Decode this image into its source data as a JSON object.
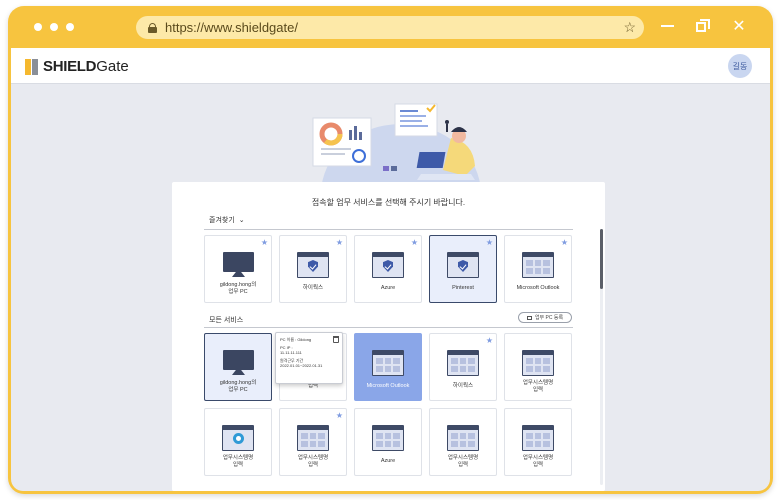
{
  "browser": {
    "url": "https://www.shieldgate/"
  },
  "app": {
    "logo_bold": "SHIELD",
    "logo_rest": "Gate",
    "avatar_text": "길동"
  },
  "panel": {
    "instruction": "접속할 업무 서비스를 선택해 주시기 바랍니다.",
    "favorites_label": "즐겨찾기",
    "all_services_label": "모든 서비스",
    "register_pc_button": "업무 PC 등록"
  },
  "favorites": [
    {
      "label": "gildong.hong의\n업무 PC",
      "icon": "monitor-icon",
      "starred": true,
      "state": "normal"
    },
    {
      "label": "하이웍스",
      "icon": "shield-window-icon",
      "starred": true,
      "state": "normal"
    },
    {
      "label": "Azure",
      "icon": "shield-window-icon",
      "starred": true,
      "state": "normal"
    },
    {
      "label": "Pinterest",
      "icon": "shield-window-icon",
      "starred": true,
      "state": "selected"
    },
    {
      "label": "Microsoft Outlook",
      "icon": "grid-window-icon",
      "starred": true,
      "state": "normal"
    }
  ],
  "all_services": [
    {
      "label": "gildong.hong의\n업무 PC",
      "icon": "monitor-icon",
      "starred": false,
      "state": "selected"
    },
    {
      "label": "입력",
      "icon": "grid-window-icon",
      "starred": false,
      "state": "normal"
    },
    {
      "label": "Microsoft Outlook",
      "icon": "grid-window-icon",
      "starred": false,
      "state": "active"
    },
    {
      "label": "하이웍스",
      "icon": "grid-window-icon",
      "starred": true,
      "state": "normal"
    },
    {
      "label": "업무시스템명\n입력",
      "icon": "grid-window-icon",
      "starred": false,
      "state": "normal"
    },
    {
      "label": "업무시스템명\n입력",
      "icon": "camera-window-icon",
      "starred": false,
      "state": "normal"
    },
    {
      "label": "업무시스템명\n입력",
      "icon": "grid-window-icon",
      "starred": true,
      "state": "normal"
    },
    {
      "label": "Azure",
      "icon": "grid-window-icon",
      "starred": false,
      "state": "normal"
    },
    {
      "label": "업무시스템명\n입력",
      "icon": "grid-window-icon",
      "starred": false,
      "state": "normal"
    },
    {
      "label": "업무시스템명\n입력",
      "icon": "grid-window-icon",
      "starred": false,
      "state": "normal"
    }
  ],
  "tooltip": {
    "pc_name": "PC 이름 : Gildong",
    "pc_ip_label": "PC IP :",
    "pc_ip": "11.11.11.111",
    "period_label": "원격근무 기간",
    "period": "2022.01.01~2022.01.31"
  },
  "colors": {
    "frame": "#f7c43f",
    "accent": "#8aa6e8",
    "star": "#7e9be0"
  }
}
